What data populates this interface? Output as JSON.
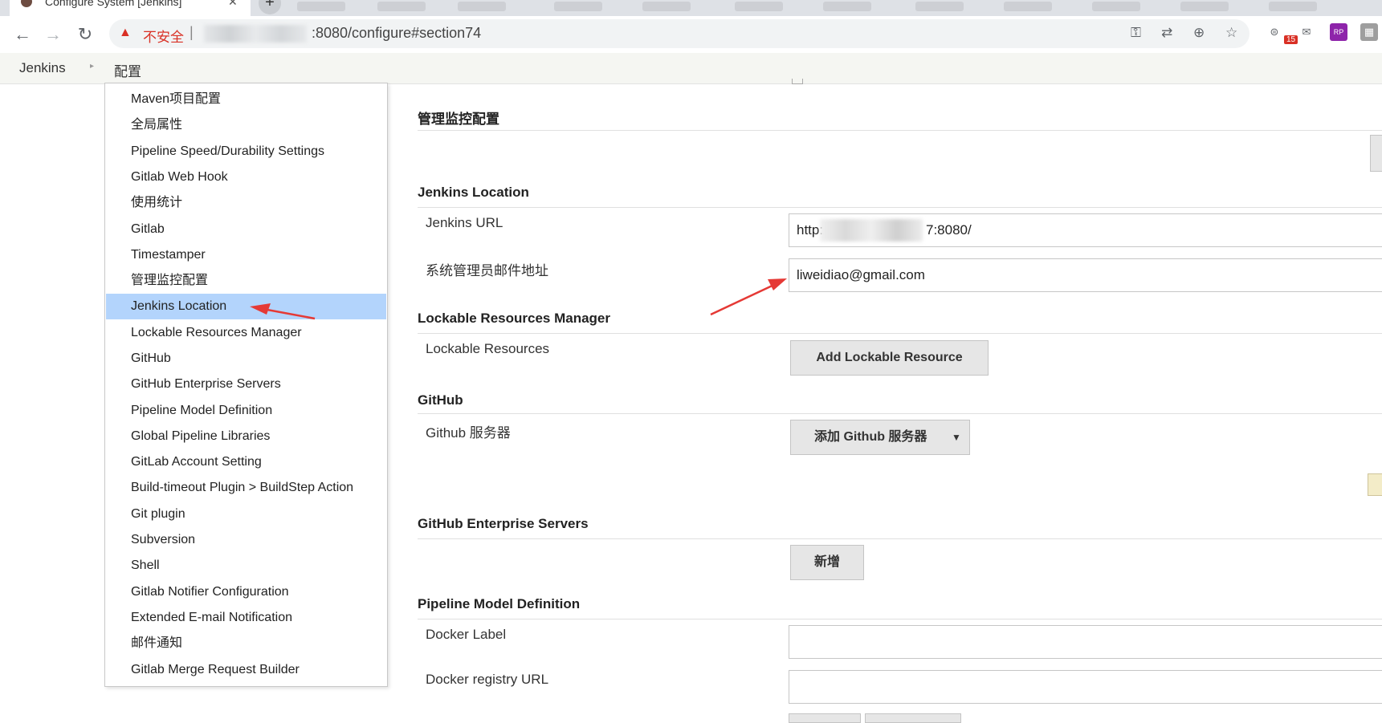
{
  "browser": {
    "tab_title": "Configure System [Jenkins]",
    "tab_close": "✕",
    "new_tab": "+",
    "insecure_label": "不安全",
    "separator": "|",
    "url_visible": ":8080/configure#section74",
    "mail_badge": "15"
  },
  "breadcrumb": {
    "items": [
      "Jenkins",
      "配置"
    ],
    "separator": "▸"
  },
  "menu": {
    "active_index": 8,
    "items": [
      "Maven项目配置",
      "全局属性",
      "Pipeline Speed/Durability Settings",
      "Gitlab Web Hook",
      "使用统计",
      "Gitlab",
      "Timestamper",
      "管理监控配置",
      "Jenkins Location",
      "Lockable Resources Manager",
      "GitHub",
      "GitHub Enterprise Servers",
      "Pipeline Model Definition",
      "Global Pipeline Libraries",
      "GitLab Account Setting",
      "Build-timeout Plugin > BuildStep Action",
      "Git plugin",
      "Subversion",
      "Shell",
      "Gitlab Notifier Configuration",
      "Extended E-mail Notification",
      "邮件通知",
      "Gitlab Merge Request Builder"
    ]
  },
  "sections": {
    "monitor": {
      "title": "管理监控配置"
    },
    "location": {
      "title": "Jenkins Location",
      "url_label": "Jenkins URL",
      "url_prefix": "http:/",
      "url_suffix": "7:8080/",
      "email_label": "系统管理员邮件地址",
      "email_value": "liweidiao@gmail.com"
    },
    "lockable": {
      "title": "Lockable Resources Manager",
      "label": "Lockable Resources",
      "button": "Add Lockable Resource"
    },
    "github": {
      "title": "GitHub",
      "label": "Github 服务器",
      "button": "添加 Github 服务器"
    },
    "enterprise": {
      "title": "GitHub Enterprise Servers",
      "button": "新增"
    },
    "pipeline": {
      "title": "Pipeline Model Definition",
      "docker_label": "Docker Label",
      "docker_label_value": "",
      "registry_label": "Docker registry URL",
      "registry_value": ""
    }
  },
  "annotations": {
    "arrow_color": "#e53935"
  },
  "colors": {
    "menu_highlight": "#b3d4fc",
    "warning": "#d93025"
  }
}
